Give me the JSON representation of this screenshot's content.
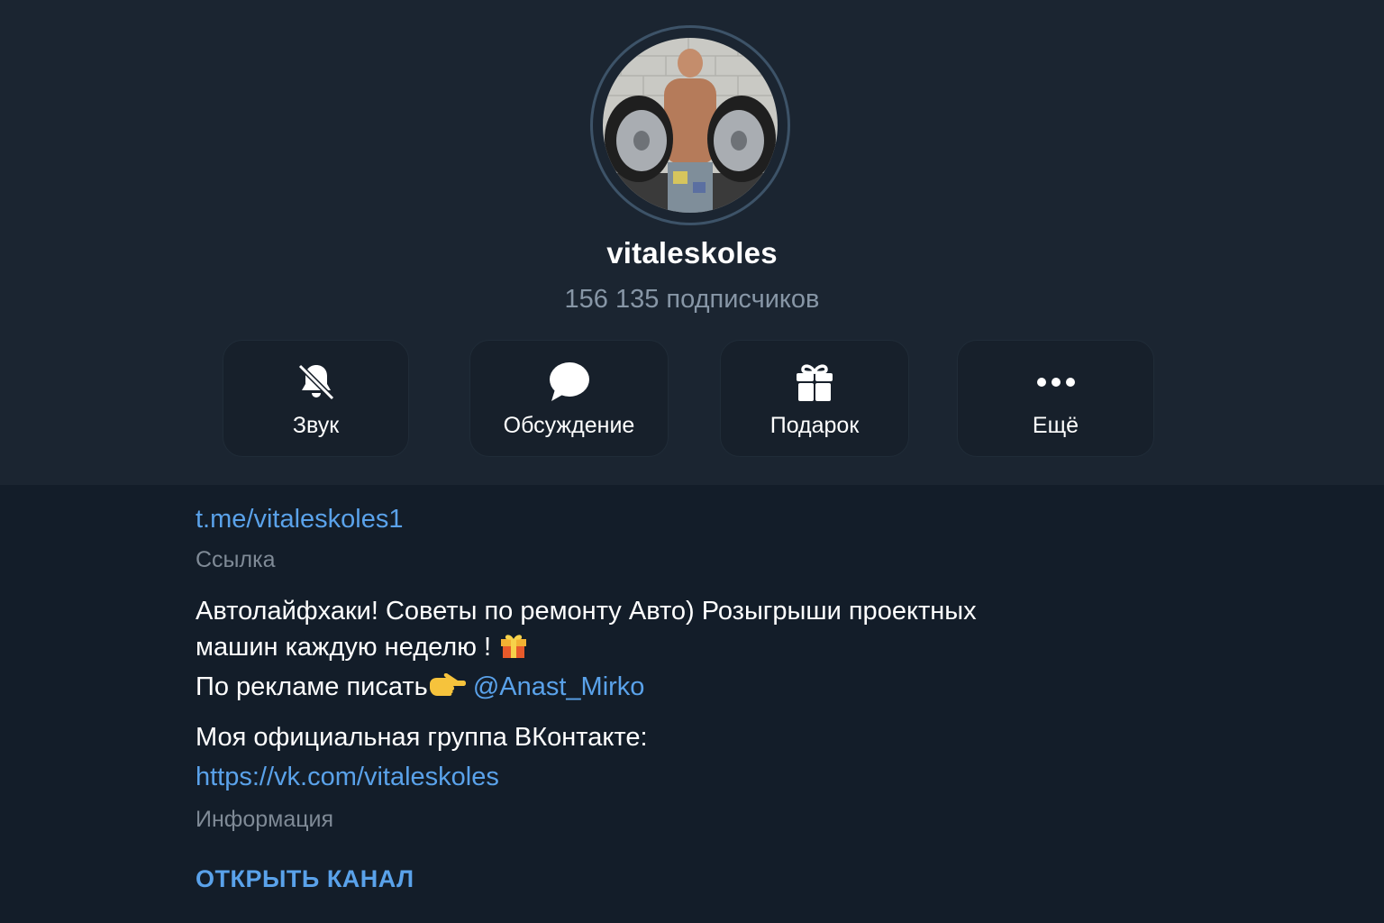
{
  "profile": {
    "name": "vitaleskoles",
    "subscribers": "156 135 подписчиков",
    "avatar_icon": "channel-avatar-photo"
  },
  "actions": [
    {
      "label": "Звук",
      "icon": "bell-muted-icon"
    },
    {
      "label": "Обсуждение",
      "icon": "chat-bubble-icon"
    },
    {
      "label": "Подарок",
      "icon": "gift-icon"
    },
    {
      "label": "Ещё",
      "icon": "more-dots-icon"
    }
  ],
  "info": {
    "link": "t.me/vitaleskoles1",
    "link_label": "Ссылка",
    "description_line1": "Автолайфхаки! Советы по ремонту Авто) Розыгрыши проектных",
    "description_line2": "машин каждую неделю !",
    "description_line3": "По рекламе писать",
    "mention": "@Anast_Mirko",
    "vk_title": "Моя официальная группа ВКонтакте:",
    "vk_url": "https://vk.com/vitaleskoles",
    "info_label": "Информация",
    "open_channel": "ОТКРЫТЬ КАНАЛ"
  },
  "colors": {
    "header_bg": "#1b2531",
    "body_bg": "#131d29",
    "accent_link": "#5aa2ea",
    "muted_text": "#8796a6"
  }
}
